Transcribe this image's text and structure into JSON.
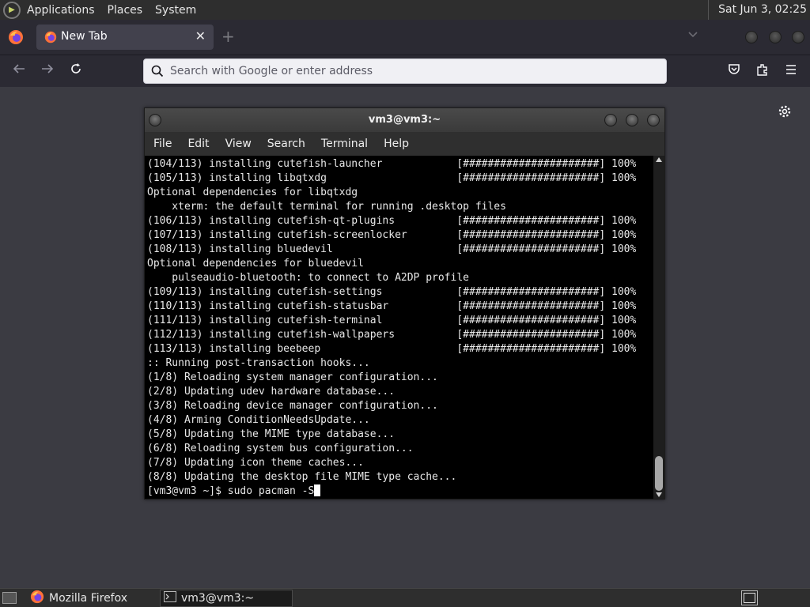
{
  "top_panel": {
    "menus": [
      "Applications",
      "Places",
      "System"
    ],
    "clock": "Sat Jun  3, 02:25"
  },
  "browser": {
    "tab_title": "New Tab",
    "tab_close": "✕",
    "new_tab": "+",
    "url_placeholder": "Search with Google or enter address"
  },
  "terminal": {
    "title": "vm3@vm3:~",
    "menu": [
      "File",
      "Edit",
      "View",
      "Search",
      "Terminal",
      "Help"
    ],
    "lines": [
      "(104/113) installing cutefish-launcher            [######################] 100%",
      "(105/113) installing libqtxdg                     [######################] 100%",
      "Optional dependencies for libqtxdg",
      "    xterm: the default terminal for running .desktop files",
      "(106/113) installing cutefish-qt-plugins          [######################] 100%",
      "(107/113) installing cutefish-screenlocker        [######################] 100%",
      "(108/113) installing bluedevil                    [######################] 100%",
      "Optional dependencies for bluedevil",
      "    pulseaudio-bluetooth: to connect to A2DP profile",
      "(109/113) installing cutefish-settings            [######################] 100%",
      "(110/113) installing cutefish-statusbar           [######################] 100%",
      "(111/113) installing cutefish-terminal            [######################] 100%",
      "(112/113) installing cutefish-wallpapers          [######################] 100%",
      "(113/113) installing beebeep                      [######################] 100%",
      ":: Running post-transaction hooks...",
      "(1/8) Reloading system manager configuration...",
      "(2/8) Updating udev hardware database...",
      "(3/8) Reloading device manager configuration...",
      "(4/8) Arming ConditionNeedsUpdate...",
      "(5/8) Updating the MIME type database...",
      "(6/8) Reloading system bus configuration...",
      "(7/8) Updating icon theme caches...",
      "(8/8) Updating the desktop file MIME type cache..."
    ],
    "prompt": "[vm3@vm3 ~]$ sudo pacman -S"
  },
  "taskbar": {
    "items": [
      "Mozilla Firefox",
      "vm3@vm3:~"
    ]
  },
  "colors": {
    "terminal_bg": "#000000",
    "browser_chrome": "#2b2a33",
    "content_bg": "#3b3b42"
  }
}
